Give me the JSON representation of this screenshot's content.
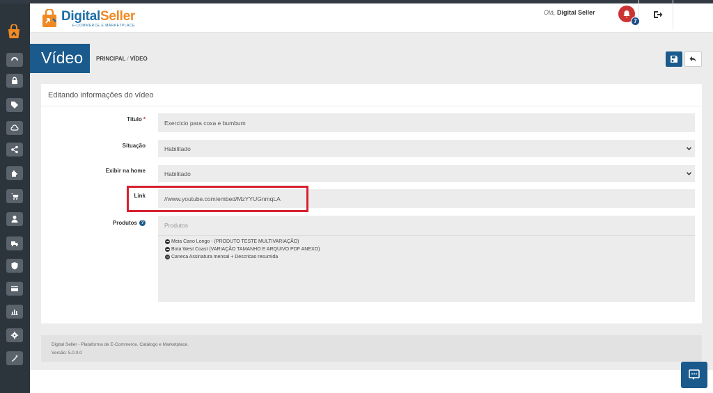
{
  "header": {
    "brand": {
      "name_part1": "Digital",
      "name_part2": "Seller",
      "tagline": "E-COMMERCE E MARKETPLACE"
    },
    "greeting_prefix": "Olá,",
    "user_name": "Digital Seller",
    "notifications_count": "7"
  },
  "sidebar": {
    "icons": [
      "dashboard-icon",
      "lock-icon",
      "tags-icon",
      "cloud-icon",
      "share-icon",
      "puzzle-icon",
      "cart-icon",
      "user-icon",
      "truck-icon",
      "shield-icon",
      "credit-card-icon",
      "bar-chart-icon",
      "gear-icon",
      "magic-wand-icon"
    ]
  },
  "page": {
    "title": "Vídeo",
    "breadcrumb": {
      "home": "PRINCIPAL",
      "separator": "/",
      "current": "VÍDEO"
    }
  },
  "form": {
    "heading": "Editando informações do vídeo",
    "titulo": {
      "label": "Título",
      "required_mark": "*",
      "value": "Exercicio para coxa e bumbum"
    },
    "situacao": {
      "label": "Situação",
      "value": "Habilitado"
    },
    "exibir_home": {
      "label": "Exibir na home",
      "value": "Habilitado"
    },
    "link": {
      "label": "Link",
      "value": "//www.youtube.com/embed/MzYYUGnmqLA"
    },
    "produtos": {
      "label": "Produtos",
      "help_glyph": "?",
      "placeholder": "Produtos",
      "items": [
        "Meia Cano Longo - (PRODUTO TESTE MULTIVARIAÇÃO)",
        "Bota West Coast (VARIAÇÃO TAMANHO E ARQUIVO PDF ANEXO)",
        "Caneca Assinatura mensal + Descricao resumida"
      ]
    }
  },
  "footer": {
    "line1": "Digital Seller - Plataforma de E-Commerce, Catálogo e Marketplace.",
    "line2": "Versão: 5.0.0.0"
  },
  "colors": {
    "primary": "#1a5a8c",
    "sidebar": "#2d353c",
    "accent_orange": "#f08a24",
    "alert_red": "#cc3333",
    "highlight_red": "#d62030"
  }
}
